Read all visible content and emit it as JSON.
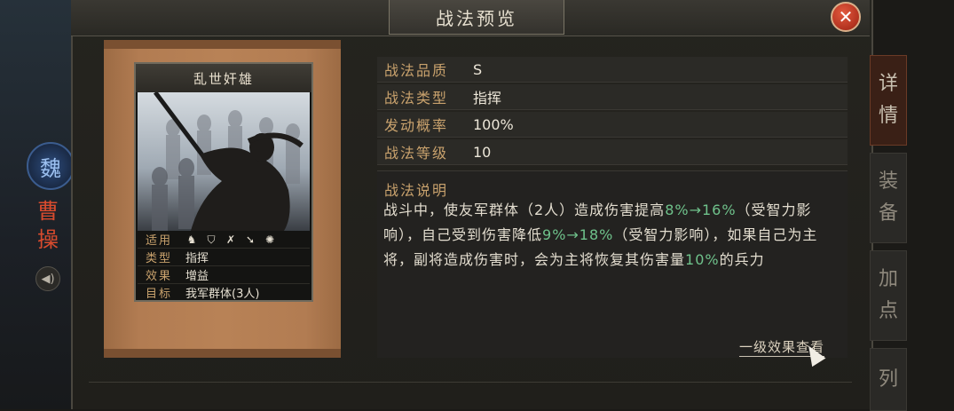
{
  "background": {
    "faction": "魏",
    "hero_name": [
      "曹",
      "操"
    ],
    "sound_icon": "speaker-icon"
  },
  "dialog": {
    "title": "战法预览",
    "close_icon": "close-icon"
  },
  "side_tabs": [
    {
      "label": [
        "详",
        "情"
      ],
      "active": true
    },
    {
      "label": [
        "装",
        "备"
      ],
      "active": false
    },
    {
      "label": [
        "加",
        "点"
      ],
      "active": false
    },
    {
      "label": [
        "列",
        ""
      ],
      "active": false
    }
  ],
  "card": {
    "title": "乱世奸雄",
    "info": {
      "applicable_label": "适用",
      "applicable_icons": [
        "cavalry-icon",
        "shield-icon",
        "bow-icon",
        "spear-icon",
        "wheel-icon"
      ],
      "type_label": "类型",
      "type_value": "指挥",
      "effect_label": "效果",
      "effect_value": "增益",
      "target_label": "目标",
      "target_value": "我军群体(3人)"
    }
  },
  "stats": [
    {
      "label": "战法品质",
      "value": "S"
    },
    {
      "label": "战法类型",
      "value": "指挥"
    },
    {
      "label": "发动概率",
      "value": "100%"
    },
    {
      "label": "战法等级",
      "value": "10"
    }
  ],
  "description": {
    "title": "战法说明",
    "segments": [
      {
        "text": "战斗中，使友军群体（2人）造成伤害提高",
        "hl": false
      },
      {
        "text": "8%→16%",
        "hl": true
      },
      {
        "text": "（受智力影响），自己受到伤害降低",
        "hl": false
      },
      {
        "text": "9%→18%",
        "hl": true
      },
      {
        "text": "（受智力影响），如果自己为主将，副将造成伤害时，会为主将恢复其伤害量",
        "hl": false
      },
      {
        "text": "10%",
        "hl": true
      },
      {
        "text": "的兵力",
        "hl": false
      }
    ]
  },
  "level_link": "一级效果查看",
  "colors": {
    "accent_label": "#c9a26d",
    "highlight": "#6fc28b",
    "close_button": "#b2321f"
  }
}
